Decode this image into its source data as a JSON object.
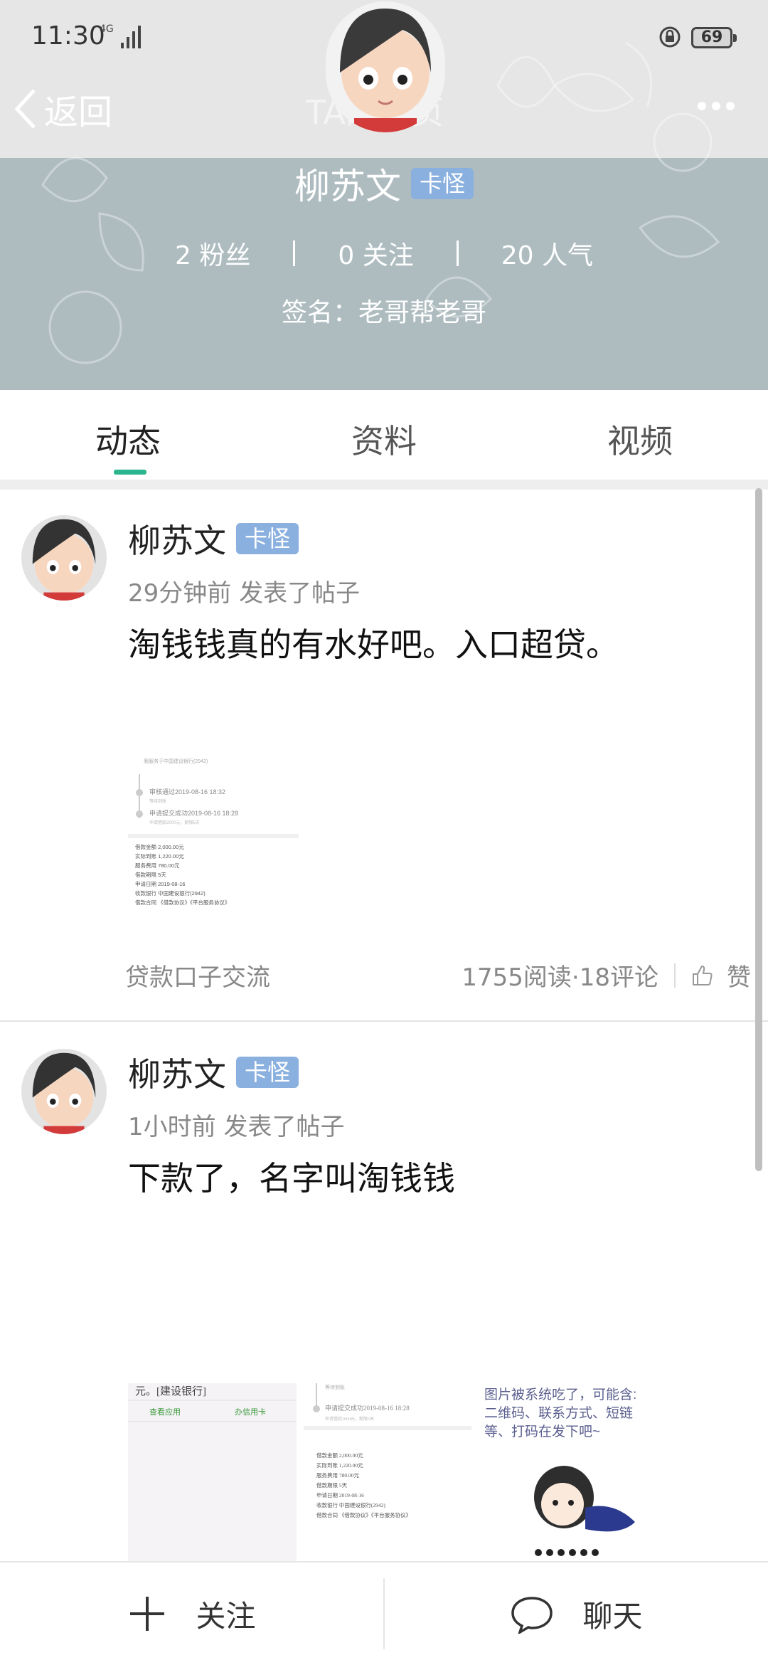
{
  "status_bar": {
    "time": "11:30",
    "network": "4G",
    "battery": "69"
  },
  "nav": {
    "back_label": "返回",
    "title": "TA的主页"
  },
  "profile": {
    "name": "柳苏文",
    "badge": "卡怪",
    "stats": {
      "fans": "2 粉丝",
      "following": "0 关注",
      "popularity": "20 人气"
    },
    "signature": "签名：老哥帮老哥"
  },
  "tabs": [
    {
      "label": "动态",
      "active": true
    },
    {
      "label": "资料",
      "active": false
    },
    {
      "label": "视频",
      "active": false
    }
  ],
  "posts": [
    {
      "author": "柳苏文",
      "badge": "卡怪",
      "meta": "29分钟前  发表了帖子",
      "text": "淘钱钱真的有水好吧。入口超贷。",
      "image_lines": {
        "head": "我服务于中国建设银行(2942)",
        "s1_title": "审核通过2019-08-16 18:32",
        "s1_sub": "等待到账",
        "s2_title": "申请提交成功2019-08-16 18:28",
        "s2_sub": "申请借款2000元，期限5天",
        "details": [
          "借款金额   2,000.00元",
          "实际到账   1,220.00元",
          "服务费用   780.00元",
          "借款期限   5天",
          "申请日期   2019-08-16",
          "收款银行   中国建设银行(2942)",
          "借款合同   《借款协议》《平台服务协议》"
        ]
      },
      "tag": "贷款口子交流",
      "stats": "1755阅读·18评论",
      "like_label": "赞"
    },
    {
      "author": "柳苏文",
      "badge": "卡怪",
      "meta": "1小时前  发表了帖子",
      "text": "下款了，名字叫淘钱钱",
      "thumb1": {
        "line1": "元。[建设银行]",
        "link1": "查看应用",
        "link2": "办信用卡"
      },
      "thumb2": {
        "line1": "等待到账",
        "line2": "申请提交成功2019-08-16 18:28",
        "line3": "申请借款2000元，期限5天",
        "details": [
          "借款金额   2,000.00元",
          "实际到账   1,220.00元",
          "服务费用   780.00元",
          "借款期限   5天",
          "申请日期   2019-08-16",
          "收款银行   中国建设银行(2942)",
          "借款合同   《借款协议》《平台服务协议》"
        ]
      },
      "thumb3": {
        "text": "图片被系统吃了，可能含:\n二维码、联系方式、短链\n等、打码在发下吧~"
      }
    }
  ],
  "bottom_bar": {
    "follow_label": "关注",
    "chat_label": "聊天"
  }
}
